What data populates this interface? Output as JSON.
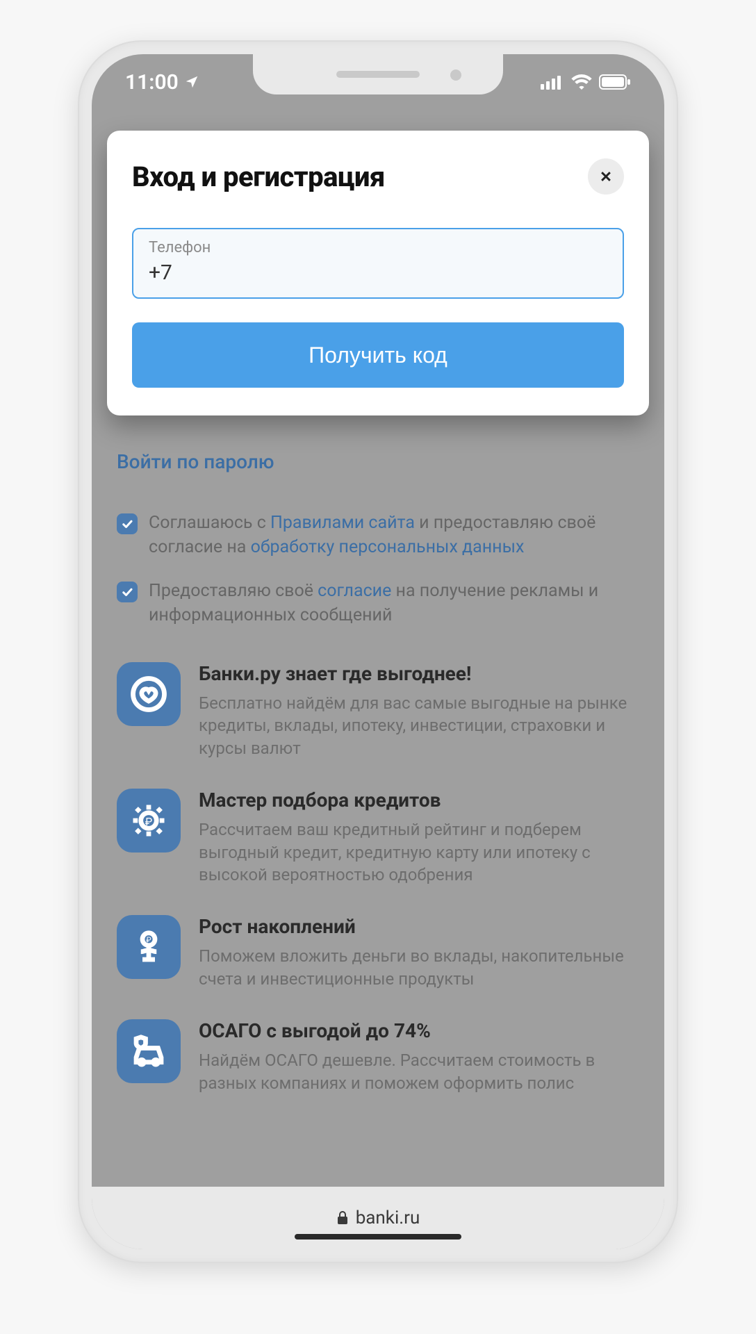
{
  "status": {
    "time": "11:00"
  },
  "modal": {
    "title": "Вход и регистрация",
    "phone_label": "Телефон",
    "phone_value": "+7",
    "submit_label": "Получить код"
  },
  "page": {
    "password_login": "Войти по паролю",
    "consent1_pre": "Соглашаюсь с ",
    "consent1_link1": "Правилами сайта",
    "consent1_mid": " и предоставляю своё согласие на ",
    "consent1_link2": "обработку персональных данных",
    "consent2_pre": "Предоставляю своё ",
    "consent2_link": "согласие",
    "consent2_post": " на получение рекламы и информационных сообщений"
  },
  "features": [
    {
      "title": "Банки.ру знает где выгоднее!",
      "desc": "Бесплатно найдём для вас самые выгодные на рынке кредиты, вклады, ипотеку, инвестиции, страховки и курсы валют"
    },
    {
      "title": "Мастер подбора кредитов",
      "desc": "Рассчитаем ваш кредитный рейтинг и подберем выгодный кредит, кредитную карту или ипотеку с высокой вероятностью одобрения"
    },
    {
      "title": "Рост накоплений",
      "desc": "Поможем вложить деньги во вклады, накопительные счета и инвестиционные продукты"
    },
    {
      "title": "ОСАГО с выгодой до 74%",
      "desc": "Найдём ОСАГО дешевле. Рассчитаем стоимость в разных компаниях и поможем оформить полис"
    }
  ],
  "browser": {
    "domain": "banki.ru"
  }
}
